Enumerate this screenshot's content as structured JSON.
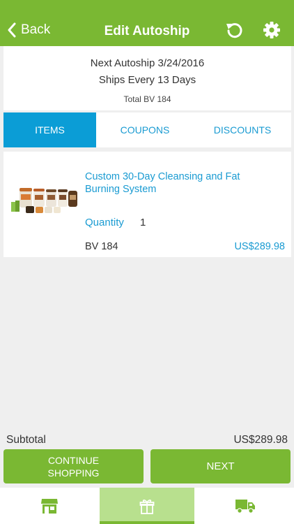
{
  "header": {
    "back_label": "Back",
    "title": "Edit Autoship",
    "icons": [
      "chevron-left-icon",
      "refresh-icon",
      "gear-icon"
    ]
  },
  "autoship": {
    "next": "Next Autoship 3/24/2016",
    "frequency": "Ships Every 13 Days",
    "total_bv": "Total BV 184"
  },
  "tabs": [
    {
      "label": "ITEMS",
      "active": true
    },
    {
      "label": "COUPONS",
      "active": false
    },
    {
      "label": "DISCOUNTS",
      "active": false
    }
  ],
  "items": [
    {
      "name": "Custom 30-Day Cleansing and Fat Burning System",
      "quantity_label": "Quantity",
      "quantity": "1",
      "bv": "BV 184",
      "price": "US$289.98"
    }
  ],
  "summary": {
    "subtotal_label": "Subtotal",
    "subtotal_value": "US$289.98"
  },
  "actions": {
    "continue_label": "CONTINUE\nSHOPPING",
    "next_label": "NEXT"
  },
  "bottom_nav": {
    "items": [
      {
        "icon": "store-icon",
        "active": false
      },
      {
        "icon": "gift-icon",
        "active": true
      },
      {
        "icon": "truck-icon",
        "active": false
      }
    ]
  },
  "colors": {
    "brand_green": "#7ab833",
    "active_tab_blue": "#0b9dd6",
    "link_blue": "#1a9bd2",
    "active_nav_bg": "#b8e08e"
  }
}
